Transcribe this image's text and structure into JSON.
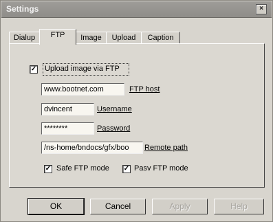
{
  "window": {
    "title": "Settings",
    "close_glyph": "×"
  },
  "tabs": [
    {
      "label": "Dialup"
    },
    {
      "label": "FTP"
    },
    {
      "label": "Image"
    },
    {
      "label": "Upload"
    },
    {
      "label": "Caption"
    }
  ],
  "upload": {
    "label": "Upload image via FTP",
    "checked": true,
    "check_glyph": "✓"
  },
  "fields": {
    "host": {
      "value": "www.bootnet.com",
      "label": "FTP host"
    },
    "username": {
      "value": "dvincent",
      "label": "Username"
    },
    "password": {
      "value": "********",
      "label": "Password"
    },
    "remote_path": {
      "value": "/ns-home/bndocs/gfx/boo",
      "label": "Remote path"
    }
  },
  "options": {
    "safe_ftp": {
      "label": "Safe FTP mode",
      "checked": true
    },
    "pasv_ftp": {
      "label": "Pasv FTP mode",
      "checked": true
    }
  },
  "buttons": {
    "ok": "OK",
    "cancel": "Cancel",
    "apply": "Apply",
    "help": "Help"
  }
}
